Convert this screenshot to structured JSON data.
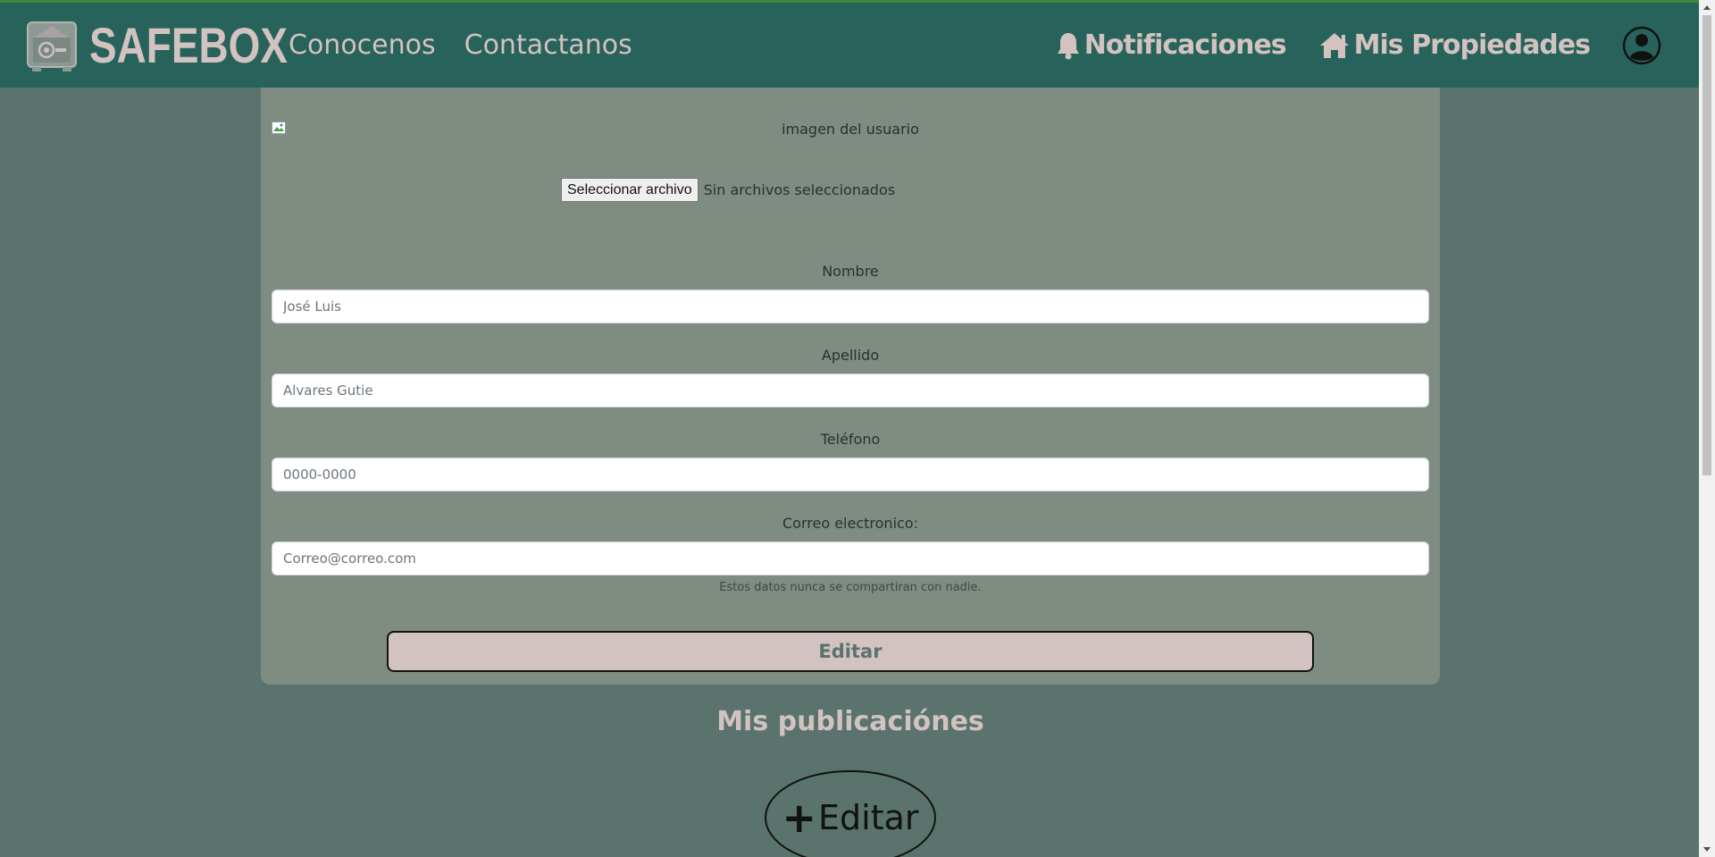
{
  "navbar": {
    "brand": "SAFEBOX",
    "links": [
      "Conocenos",
      "Contactanos"
    ],
    "notifications_label": "Notificaciones",
    "properties_label": "Mis Propiedades",
    "icons": [
      "safe-icon",
      "bell-icon",
      "house-icon",
      "user-circle-icon"
    ]
  },
  "profile_form": {
    "image_alt": "imagen del usuario",
    "file_button": "Seleccionar archivo",
    "file_status": "Sin archivos seleccionados",
    "fields": [
      {
        "label": "Nombre",
        "placeholder": "José Luis"
      },
      {
        "label": "Apellido",
        "placeholder": "Alvares Gutie"
      },
      {
        "label": "Teléfono",
        "placeholder": "0000-0000"
      },
      {
        "label": "Correo electronico:",
        "placeholder": "Correo@correo.com"
      }
    ],
    "help_text": "Estos datos nunca se compartiran con nadie.",
    "submit_label": "Editar"
  },
  "publications": {
    "title": "Mis publicaciónes",
    "add_button": "Editar",
    "add_symbol": "+"
  },
  "colors": {
    "navbar": "#28635b",
    "background": "#5a736d",
    "card": "#7f8c82",
    "accent": "#d2c2c0"
  }
}
